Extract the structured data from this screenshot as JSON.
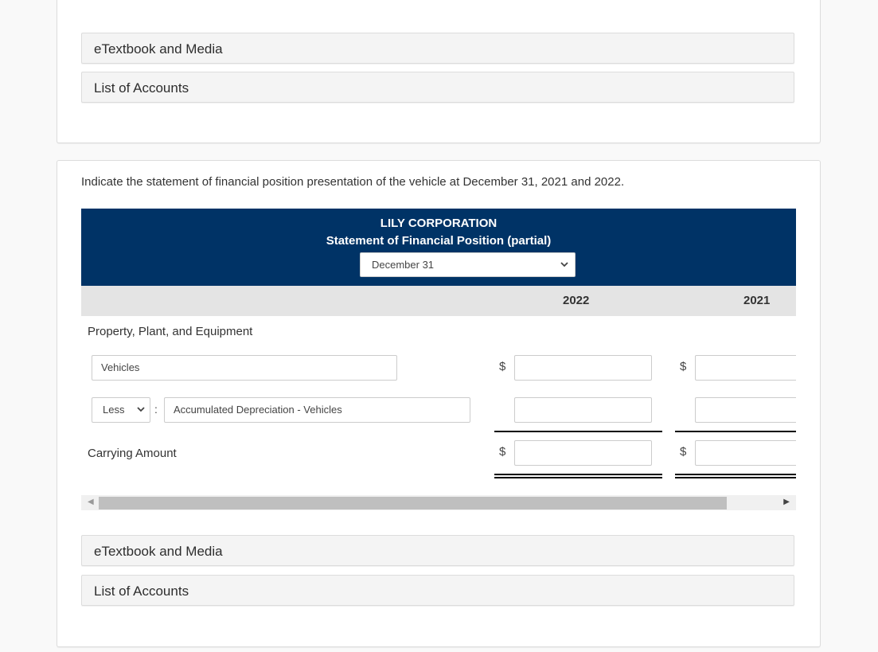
{
  "top_card": {
    "accordions": [
      {
        "label": "eTextbook and Media"
      },
      {
        "label": "List of Accounts"
      }
    ]
  },
  "main": {
    "instruction": "Indicate the statement of financial position presentation of the vehicle at December 31, 2021 and 2022.",
    "header": {
      "company": "LILY CORPORATION",
      "statement": "Statement of Financial Position (partial)",
      "date_select": {
        "value": "December 31"
      }
    },
    "columns": [
      "2022",
      "2021"
    ],
    "section_label": "Property, Plant, and Equipment",
    "rows": [
      {
        "account": "Vehicles",
        "currency": "$",
        "values": [
          "",
          ""
        ]
      },
      {
        "modifier": "Less",
        "separator": ":",
        "account": "Accumulated Depreciation - Vehicles",
        "values": [
          "",
          ""
        ]
      },
      {
        "label": "Carrying Amount",
        "currency": "$",
        "values": [
          "",
          ""
        ]
      }
    ],
    "accordions": [
      {
        "label": "eTextbook and Media"
      },
      {
        "label": "List of Accounts"
      }
    ],
    "scrollbar": {
      "left_arrow": "◀",
      "right_arrow": "▶"
    }
  },
  "icons": {
    "chevron_down": "⌄"
  }
}
